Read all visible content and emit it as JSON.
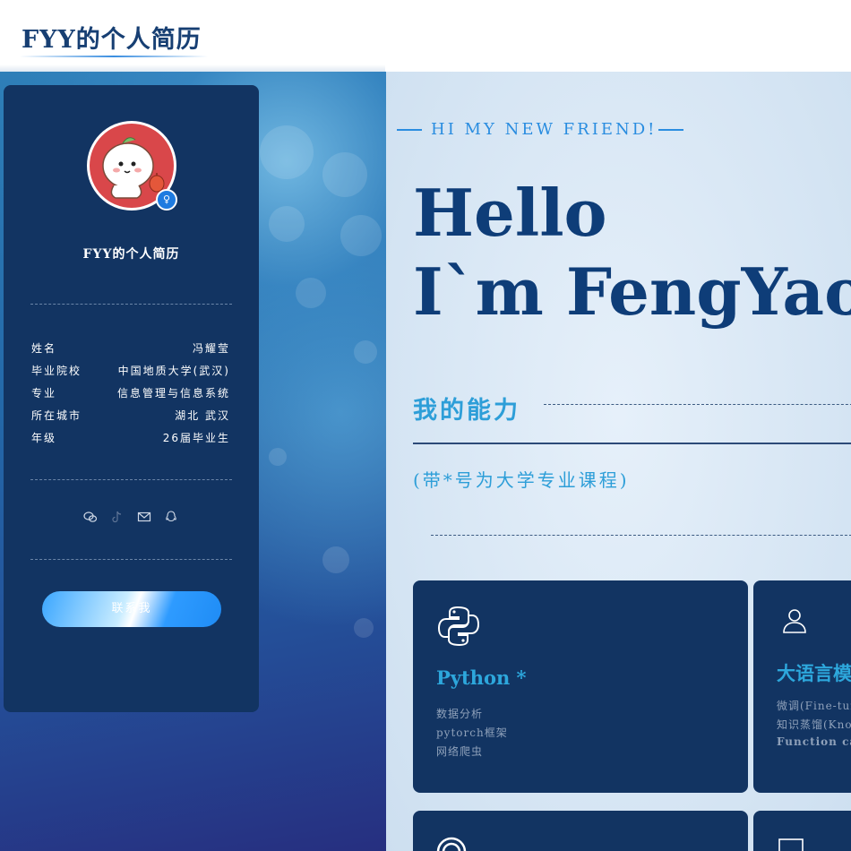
{
  "header": {
    "brand": "FYY的个人简历"
  },
  "profile": {
    "title": "FYY的个人简历",
    "badge_icon": "verified-badge-icon",
    "info": [
      {
        "key": "姓名",
        "value": "冯耀莹"
      },
      {
        "key": "毕业院校",
        "value": "中国地质大学(武汉)"
      },
      {
        "key": "专业",
        "value": "信息管理与信息系统"
      },
      {
        "key": "所在城市",
        "value": "湖北 武汉"
      },
      {
        "key": "年级",
        "value": "26届毕业生"
      }
    ],
    "social_icons": [
      "wechat-icon",
      "tiktok-icon",
      "mail-icon",
      "qq-icon"
    ],
    "contact_label": "联系我"
  },
  "hero": {
    "eyebrow": "HI MY NEW FRIEND!",
    "hello": "Hello",
    "name": "I`m FengYaoYing"
  },
  "abilities": {
    "heading": "我的能力",
    "note": "(带*号为大学专业课程)",
    "cards": [
      {
        "icon": "python-icon",
        "title": "Python *",
        "items": [
          "数据分析",
          "pytorch框架",
          "网络爬虫"
        ]
      },
      {
        "icon": "user-icon",
        "title": "大语言模型",
        "items": [
          "微调(Fine-tuning)",
          "知识蒸馏(Knowledge Distillation)",
          "Function calling"
        ]
      },
      {
        "icon": "target-icon",
        "title": "",
        "items": []
      },
      {
        "icon": "monitor-icon",
        "title": "",
        "items": []
      }
    ]
  },
  "colors": {
    "navy": "#123462",
    "accent": "#2da7dc",
    "heading": "#0e3d78"
  }
}
